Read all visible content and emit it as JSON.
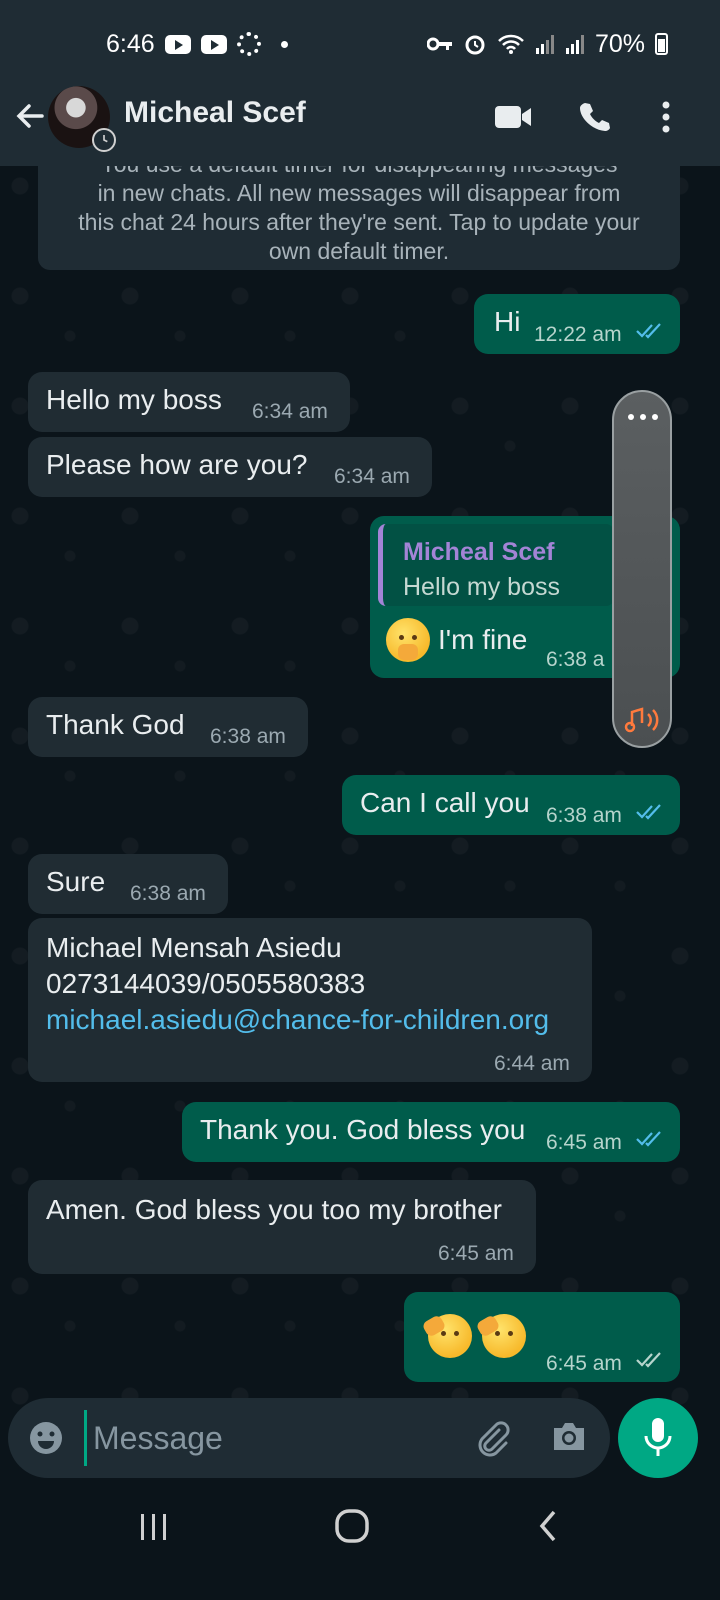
{
  "status_bar": {
    "time": "6:46",
    "battery": "70%"
  },
  "header": {
    "contact_name": "Micheal Scef"
  },
  "system_message": {
    "lines": [
      "You use a default timer for disappearing messages",
      "in new chats. All new messages will disappear from",
      "this chat 24 hours after they're sent. Tap to update your",
      "own default timer."
    ]
  },
  "messages": [
    {
      "dir": "out",
      "text": "Hi",
      "time": "12:22 am",
      "read": true
    },
    {
      "dir": "in",
      "text": "Hello my boss",
      "time": "6:34 am"
    },
    {
      "dir": "in",
      "text": "Please how are you?",
      "time": "6:34 am"
    },
    {
      "dir": "out",
      "quote_name": "Micheal Scef",
      "quote_text": "Hello my boss",
      "text": "I'm fine",
      "time": "6:38 a"
    },
    {
      "dir": "in",
      "text": "Thank God",
      "time": "6:38 am"
    },
    {
      "dir": "out",
      "text": "Can I call you",
      "time": "6:38 am",
      "read": true
    },
    {
      "dir": "in",
      "text": "Sure",
      "time": "6:38 am"
    },
    {
      "dir": "in",
      "line1": "Michael Mensah Asiedu",
      "line2": "0273144039/0505580383",
      "link": "michael.asiedu@chance-for-children.org",
      "time": "6:44 am"
    },
    {
      "dir": "out",
      "text": "Thank you. God bless you",
      "time": "6:45 am",
      "read": true
    },
    {
      "dir": "in",
      "text": "Amen. God bless you too my brother",
      "time": "6:45 am"
    },
    {
      "dir": "out",
      "emoji": "saluting-face x2",
      "time": "6:45 am",
      "read": false
    }
  ],
  "input": {
    "placeholder": "Message"
  },
  "colors": {
    "header_bg": "#1f2c34",
    "chat_bg": "#0b141a",
    "incoming_bubble": "#202c33",
    "outgoing_bubble": "#005c4b",
    "accent": "#00a884",
    "read_ticks": "#53bdeb",
    "link": "#53bdeb"
  }
}
